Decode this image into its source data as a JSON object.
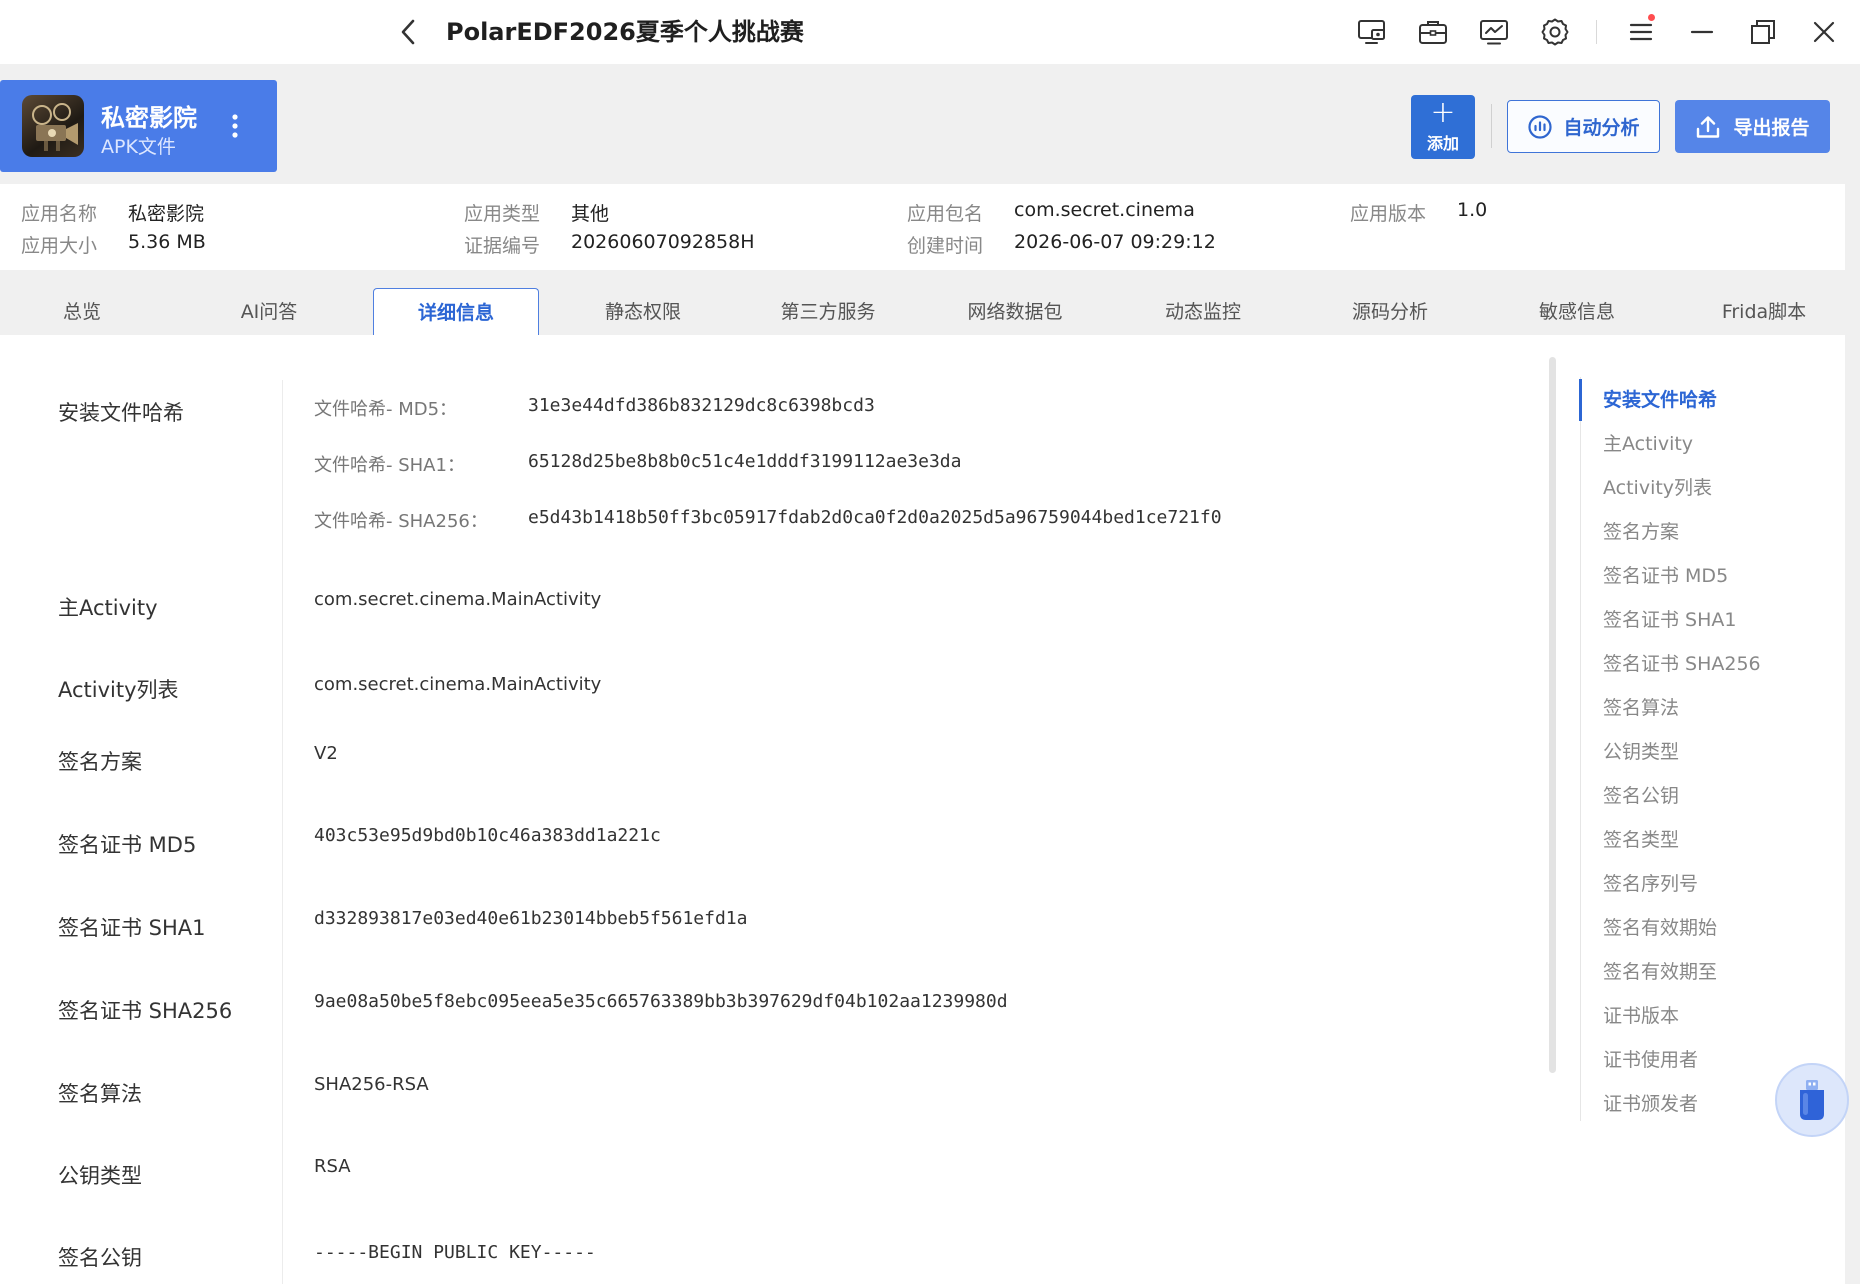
{
  "window": {
    "title": "PolarEDF2026夏季个人挑战赛"
  },
  "app": {
    "name": "私密影院",
    "type": "APK文件"
  },
  "actions": {
    "add_label": "添加",
    "auto_analyze_label": "自动分析",
    "export_label": "导出报告"
  },
  "info": {
    "name_key": "应用名称",
    "name_val": "私密影院",
    "size_key": "应用大小",
    "size_val": "5.36 MB",
    "kind_key": "应用类型",
    "kind_val": "其他",
    "evidence_key": "证据编号",
    "evidence_val": "20260607092858H",
    "package_key": "应用包名",
    "package_val": "com.secret.cinema",
    "created_key": "创建时间",
    "created_val": "2026-06-07 09:29:12",
    "version_key": "应用版本",
    "version_val": "1.0"
  },
  "tabs": [
    {
      "label": "总览"
    },
    {
      "label": "AI问答"
    },
    {
      "label": "详细信息"
    },
    {
      "label": "静态权限"
    },
    {
      "label": "第三方服务"
    },
    {
      "label": "网络数据包"
    },
    {
      "label": "动态监控"
    },
    {
      "label": "源码分析"
    },
    {
      "label": "敏感信息"
    },
    {
      "label": "Frida脚本"
    }
  ],
  "active_tab": "详细信息",
  "details": {
    "hash": {
      "label": "安装文件哈希",
      "md5_key": "文件哈希- MD5：",
      "md5": "31e3e44dfd386b832129dc8c6398bcd3",
      "sha1_key": "文件哈希- SHA1：",
      "sha1": "65128d25be8b8b0c51c4e1dddf3199112ae3e3da",
      "sha256_key": "文件哈希- SHA256：",
      "sha256": "e5d43b1418b50ff3bc05917fdab2d0ca0f2d0a2025d5a96759044bed1ce721f0"
    },
    "main_activity": {
      "label": "主Activity",
      "value": "com.secret.cinema.MainActivity"
    },
    "activity_list": {
      "label": "Activity列表",
      "value": "com.secret.cinema.MainActivity"
    },
    "sign_scheme": {
      "label": "签名方案",
      "value": "V2"
    },
    "cert_md5": {
      "label": "签名证书 MD5",
      "value": "403c53e95d9bd0b10c46a383dd1a221c"
    },
    "cert_sha1": {
      "label": "签名证书 SHA1",
      "value": "d332893817e03ed40e61b23014bbeb5f561efd1a"
    },
    "cert_sha256": {
      "label": "签名证书 SHA256",
      "value": "9ae08a50be5f8ebc095eea5e35c665763389bb3b397629df04b102aa1239980d"
    },
    "sign_algo": {
      "label": "签名算法",
      "value": "SHA256-RSA"
    },
    "pubkey_type": {
      "label": "公钥类型",
      "value": "RSA"
    },
    "pubkey": {
      "label": "签名公钥",
      "value": "-----BEGIN PUBLIC KEY-----"
    }
  },
  "nav": [
    {
      "label": "安装文件哈希"
    },
    {
      "label": "主Activity"
    },
    {
      "label": "Activity列表"
    },
    {
      "label": "签名方案"
    },
    {
      "label": "签名证书 MD5"
    },
    {
      "label": "签名证书 SHA1"
    },
    {
      "label": "签名证书 SHA256"
    },
    {
      "label": "签名算法"
    },
    {
      "label": "公钥类型"
    },
    {
      "label": "签名公钥"
    },
    {
      "label": "签名类型"
    },
    {
      "label": "签名序列号"
    },
    {
      "label": "签名有效期始"
    },
    {
      "label": "签名有效期至"
    },
    {
      "label": "证书版本"
    },
    {
      "label": "证书使用者"
    },
    {
      "label": "证书颁发者"
    }
  ],
  "active_nav": "安装文件哈希",
  "colors": {
    "accent": "#2c66d4",
    "app_card": "#4a7ce8",
    "notification_dot": "#ff4d4f"
  }
}
